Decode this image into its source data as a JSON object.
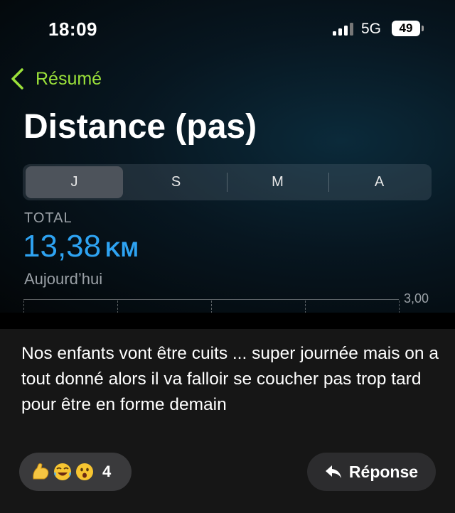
{
  "status_bar": {
    "time": "18:09",
    "network": "5G",
    "battery": "49"
  },
  "nav": {
    "back_label": "Résumé",
    "title": "Distance (pas)"
  },
  "segments": [
    "J",
    "S",
    "M",
    "A"
  ],
  "summary": {
    "label": "TOTAL",
    "value": "13,38",
    "unit": "KM",
    "date": "Aujourd’hui"
  },
  "chart": {
    "y_tick": "3,00"
  },
  "post": {
    "caption": "Nos enfants vont être cuits ... super journée mais on a tout donné alors il va falloir se coucher pas trop tard pour être en forme demain",
    "reaction_icons": [
      "flexed-biceps-emoji",
      "tears-of-joy-emoji",
      "astonished-face-emoji"
    ],
    "reaction_count": "4",
    "reply_label": "Réponse"
  },
  "colors": {
    "accent_green": "#9be13a",
    "accent_blue": "#2ea3f2"
  }
}
